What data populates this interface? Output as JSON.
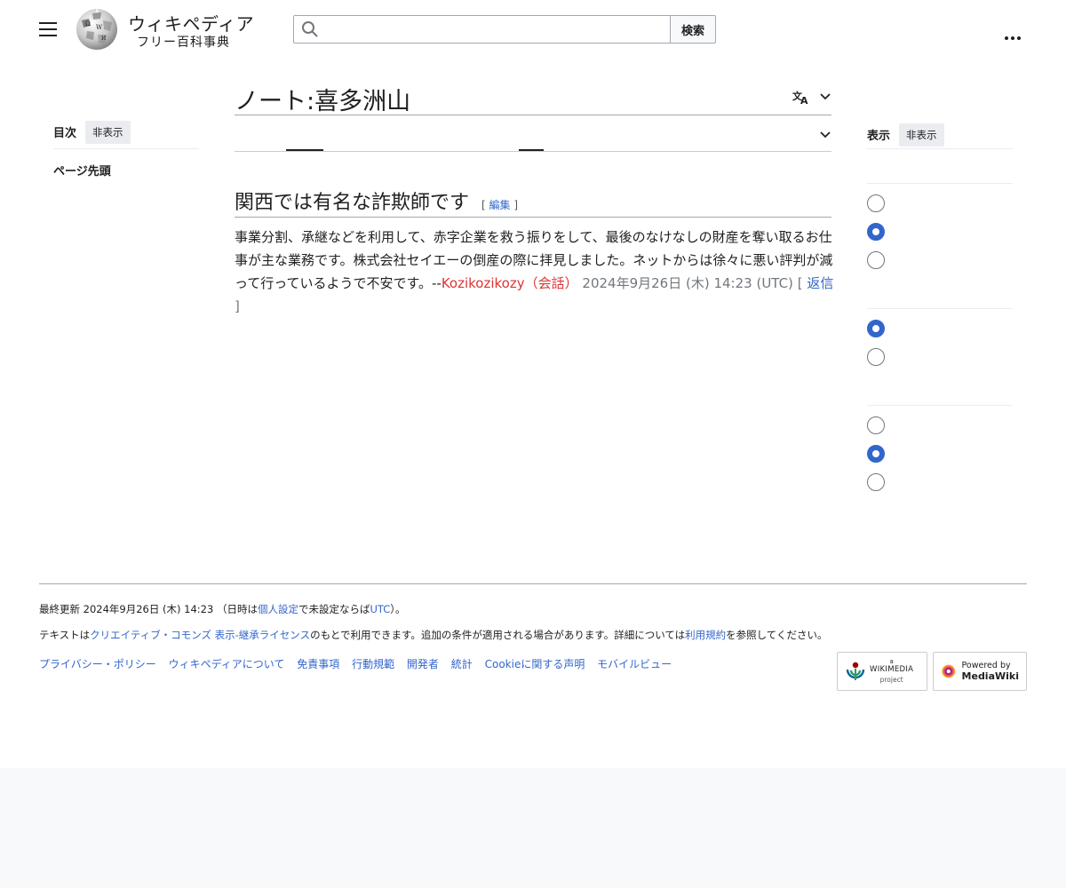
{
  "header": {
    "wordmark": "ウィキペディア",
    "tagline": "フリー百科事典",
    "search_placeholder": "",
    "search_button": "検索"
  },
  "toc": {
    "title": "目次",
    "hide_button": "非表示",
    "items": [
      {
        "label": "ページ先頭"
      }
    ]
  },
  "page": {
    "title": "ノート:喜多洲山"
  },
  "section": {
    "heading": "関西では有名な詐欺師です",
    "edit_open": "[",
    "edit_label": "編集",
    "edit_close": "]",
    "body_text": "事業分割、承継などを利用して、赤字企業を救う振りをして、最後のなけなしの財産を奪い取るお仕事が主な業務です。株式会社セイエーの倒産の際に拝見しました。ネットからは徐々に悪い評判が減って行っているようで不安です。--",
    "user_link": "Kozikozikozy",
    "talk_open": "（",
    "talk_link": "会話",
    "talk_close": "）",
    "timestamp": "2024年9月26日 (木) 14:23 (UTC)",
    "reply_open": "[",
    "reply_label": "返信",
    "reply_close": "]"
  },
  "appearance": {
    "title": "表示",
    "hide_button": "非表示",
    "radio_groups": [
      {
        "selected_index": 1,
        "count": 3
      },
      {
        "selected_index": 0,
        "count": 2
      },
      {
        "selected_index": 1,
        "count": 3
      }
    ]
  },
  "footer": {
    "last_modified_prefix": "最終更新 2024年9月26日 (木) 14:23 （日時は",
    "personal_settings": "個人設定",
    "last_modified_mid": "で未設定ならば",
    "utc": "UTC",
    "last_modified_suffix": "）。",
    "license_prefix": "テキストは",
    "license_link": "クリエイティブ・コモンズ 表示-継承ライセンス",
    "license_mid": "のもとで利用できます。追加の条件が適用される場合があります。詳細については",
    "terms_link": "利用規約",
    "license_suffix": "を参照してください。",
    "links": [
      "プライバシー・ポリシー",
      "ウィキペディアについて",
      "免責事項",
      "行動規範",
      "開発者",
      "統計",
      "Cookieに関する声明",
      "モバイルビュー"
    ],
    "wikimedia_badge": {
      "small": "a",
      "name": "WIKIMEDIA",
      "sub": "project"
    },
    "mediawiki_badge": {
      "line1": "Powered by",
      "line2": "MediaWiki"
    }
  },
  "colors": {
    "link": "#3366cc",
    "redlink": "#d33",
    "radio_selected": "#3366cc"
  }
}
